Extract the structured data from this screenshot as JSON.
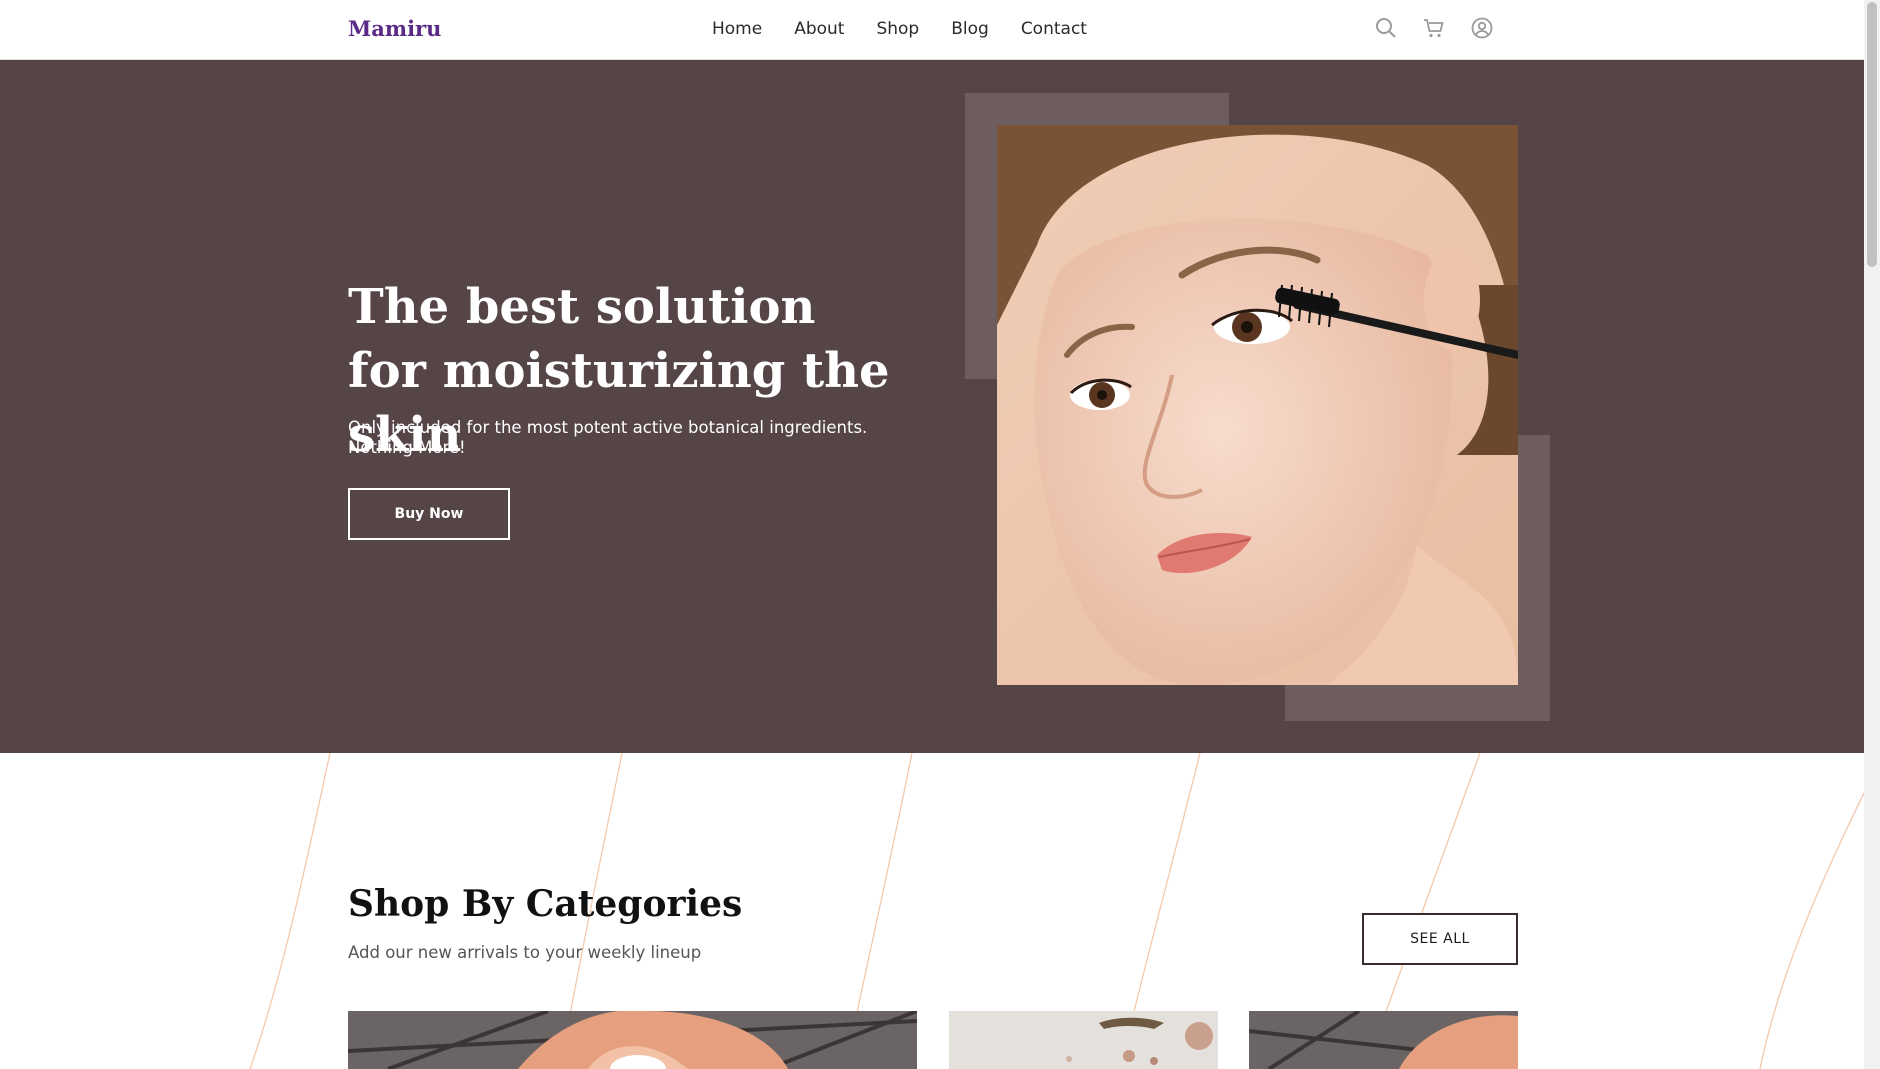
{
  "brand": {
    "name": "Mamiru",
    "color": "#5b2a86"
  },
  "nav": {
    "items": [
      {
        "label": "Home"
      },
      {
        "label": "About"
      },
      {
        "label": "Shop"
      },
      {
        "label": "Blog"
      },
      {
        "label": "Contact"
      }
    ]
  },
  "header_icons": [
    "search-icon",
    "cart-icon",
    "account-icon"
  ],
  "hero": {
    "title": "The best solution for moisturizing the skin",
    "subtitle": "Only included for the most potent active botanical ingredients. Nothing More!",
    "cta_label": "Buy Now",
    "background": "#554547",
    "frame_color": "#6e5d5f"
  },
  "categories": {
    "title": "Shop By Categories",
    "subtitle": "Add our new arrivals to your weekly lineup",
    "see_all_label": "SEE ALL",
    "cards": [
      {
        "name": "category-card-1"
      },
      {
        "name": "category-card-2"
      },
      {
        "name": "category-card-3"
      }
    ]
  },
  "colors": {
    "accent_line": "#f2c9ad",
    "text_dark": "#111111"
  }
}
